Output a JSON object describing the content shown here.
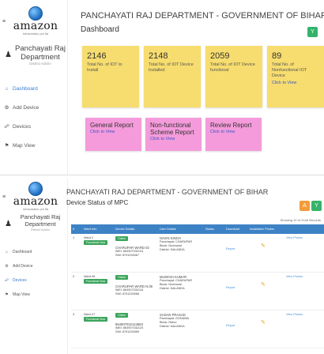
{
  "brand": {
    "name": "amazon",
    "tagline": "Infosolution pvt ltd"
  },
  "user": {
    "name": "Panchayati Raj Department",
    "role": "District Admin"
  },
  "nav": [
    {
      "label": "Dashboard",
      "icon": "home-icon"
    },
    {
      "label": "Add Device",
      "icon": "add-device-icon"
    },
    {
      "label": "Devices",
      "icon": "device-icon"
    },
    {
      "label": "Map View",
      "icon": "map-icon"
    }
  ],
  "dashboard": {
    "dept_title": "PANCHAYATI RAJ DEPARTMENT - GOVERNMENT OF BIHAR",
    "page_title": "Dashboard",
    "corner_button": "Y",
    "stats": [
      {
        "value": "2146",
        "label": "Total No. of IOT to Install",
        "link": ""
      },
      {
        "value": "2148",
        "label": "Total No. of IOT Device Installed",
        "link": ""
      },
      {
        "value": "2059",
        "label": "Total No. of IOT Device functional",
        "link": ""
      },
      {
        "value": "89",
        "label": "Total No. of Nonfunctional IOT Device",
        "link": "Click to View"
      }
    ],
    "reports": [
      {
        "title": "General Report",
        "link": "Click to View"
      },
      {
        "title": "Non-functional Scheme Report",
        "link": "Click to View"
      },
      {
        "title": "Review Report",
        "link": "Click to View"
      }
    ],
    "colors": {
      "stat": "#f7dd6f",
      "report": "#f59bdb",
      "accent": "#34b36b"
    }
  },
  "devices": {
    "dept_title": "PANCHAYATI RAJ DEPARTMENT - GOVERNMENT OF BIHAR",
    "page_title": "Device Status of MPC",
    "buttons": [
      "A",
      "Y"
    ],
    "showing": "Showing 10 of 2146 Records",
    "columns": [
      "#",
      "Ward Info",
      "Device Details",
      "User Details",
      "Status",
      "Download",
      "Installation Photos",
      ""
    ],
    "rows": [
      {
        "num": "1",
        "ward": "Ward 2",
        "ward_badge": "Functional Now",
        "device_badge": "Online",
        "device": "CHARUPAR WARD 02",
        "device_imei": "IMEI: 864907032124",
        "device_sim": "SIM: 8791234567",
        "user": "NAVIN SINGH",
        "user_panchayat": "Panchayat: CHARUPAR",
        "user_block": "Block: Noorsarai",
        "user_district": "District: NALANDA",
        "download": "Report",
        "photos": "View Photos"
      },
      {
        "num": "2",
        "ward": "Ward 06",
        "ward_badge": "Functional Now",
        "device_badge": "Online",
        "device": "CHARUPAR WARD N.06",
        "device_imei": "IMEI: 864907032118",
        "device_sim": "SIM: 8791234568",
        "user": "MUKESH KUMAR",
        "user_panchayat": "Panchayat: CHARUPAR",
        "user_block": "Block: Noorsarai",
        "user_district": "District: NALANDA",
        "download": "Report",
        "photos": "View Photos"
      },
      {
        "num": "3",
        "ward": "Ward 07",
        "ward_badge": "Functional Now",
        "device_badge": "Online",
        "device": "864907032124863",
        "device_imei": "IMEI: 864907032124",
        "device_sim": "SIM: 8791234569",
        "user": "SADAN PRASAD",
        "user_panchayat": "Panchayat: GONAWA",
        "user_block": "Block: Rahui",
        "user_district": "District: NALANDA",
        "download": "Report",
        "photos": "View Photos"
      }
    ],
    "colors": {
      "header": "#3e82c6",
      "btn_a": "#f39c3c",
      "btn_y": "#34b36b",
      "badge": "#3ca55c"
    }
  }
}
